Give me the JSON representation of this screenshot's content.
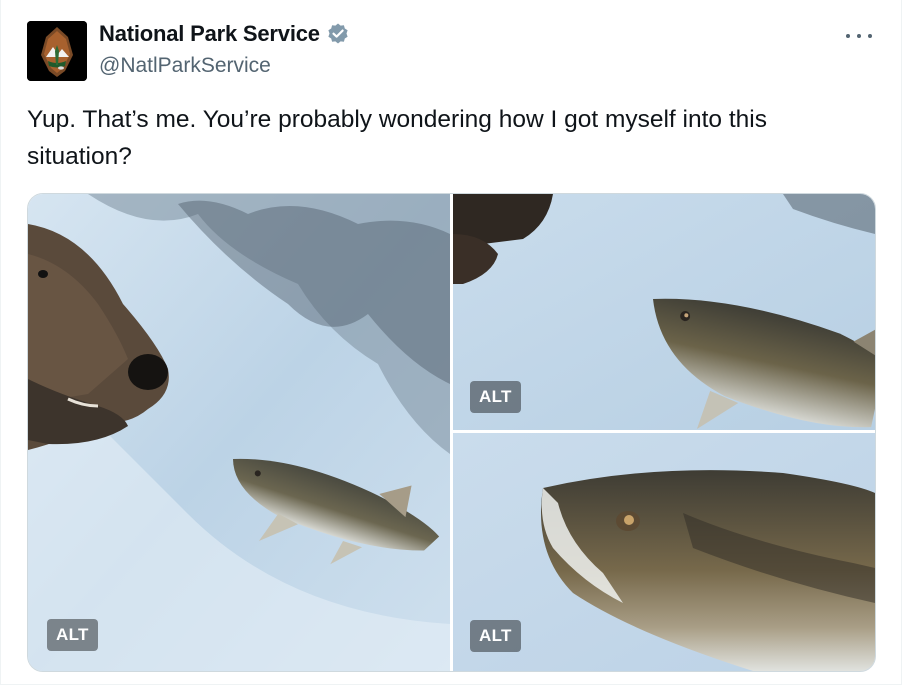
{
  "author": {
    "display_name": "National Park Service",
    "handle": "@NatlParkService",
    "verified": true,
    "avatar_icon": "nps-arrowhead-logo-icon",
    "verified_icon": "verified-badge-icon",
    "verified_color": "#829aab"
  },
  "more_icon": "more-options-icon",
  "tweet": {
    "text": "Yup. That’s me. You’re probably wondering how I got myself into this situation?"
  },
  "media": {
    "images": [
      {
        "subject": "bear-and-salmon",
        "alt_label": "ALT"
      },
      {
        "subject": "salmon-closer",
        "alt_label": "ALT"
      },
      {
        "subject": "salmon-closeup",
        "alt_label": "ALT"
      }
    ]
  },
  "colors": {
    "text": "#0f1419",
    "secondary": "#536471",
    "border": "#cfd9de"
  }
}
